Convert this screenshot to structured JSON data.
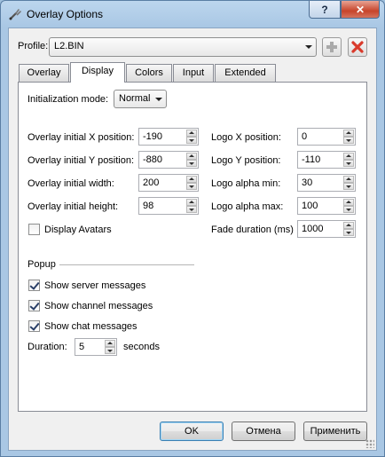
{
  "window": {
    "title": "Overlay Options",
    "help_label": "?",
    "close_label": "✕"
  },
  "profile": {
    "label": "Profile:",
    "value": "L2.BIN"
  },
  "tabs": [
    {
      "label": "Overlay",
      "active": false
    },
    {
      "label": "Display",
      "active": true
    },
    {
      "label": "Colors",
      "active": false
    },
    {
      "label": "Input",
      "active": false
    },
    {
      "label": "Extended",
      "active": false
    }
  ],
  "display": {
    "init_mode_label": "Initialization mode:",
    "init_mode_value": "Normal",
    "fields_left": [
      {
        "label": "Overlay initial X position:",
        "value": "-190"
      },
      {
        "label": "Overlay initial Y position:",
        "value": "-880"
      },
      {
        "label": "Overlay initial width:",
        "value": "200"
      },
      {
        "label": "Overlay initial height:",
        "value": "98"
      }
    ],
    "fields_right": [
      {
        "label": "Logo X position:",
        "value": "0"
      },
      {
        "label": "Logo Y position:",
        "value": "-110"
      },
      {
        "label": "Logo alpha min:",
        "value": "30"
      },
      {
        "label": "Logo alpha max:",
        "value": "100"
      },
      {
        "label": "Fade duration (ms)",
        "value": "1000"
      }
    ],
    "display_avatars": {
      "label": "Display Avatars",
      "checked": false
    },
    "popup": {
      "heading": "Popup",
      "checks": [
        {
          "label": "Show server messages",
          "checked": true
        },
        {
          "label": "Show channel messages",
          "checked": true
        },
        {
          "label": "Show chat messages",
          "checked": true
        }
      ],
      "duration_label": "Duration:",
      "duration_value": "5",
      "duration_unit": "seconds"
    }
  },
  "buttons": {
    "ok": "OK",
    "cancel": "Отмена",
    "apply": "Применить"
  },
  "colors": {
    "delete_red": "#d93a2b",
    "add_gray": "#a9a9a9"
  }
}
